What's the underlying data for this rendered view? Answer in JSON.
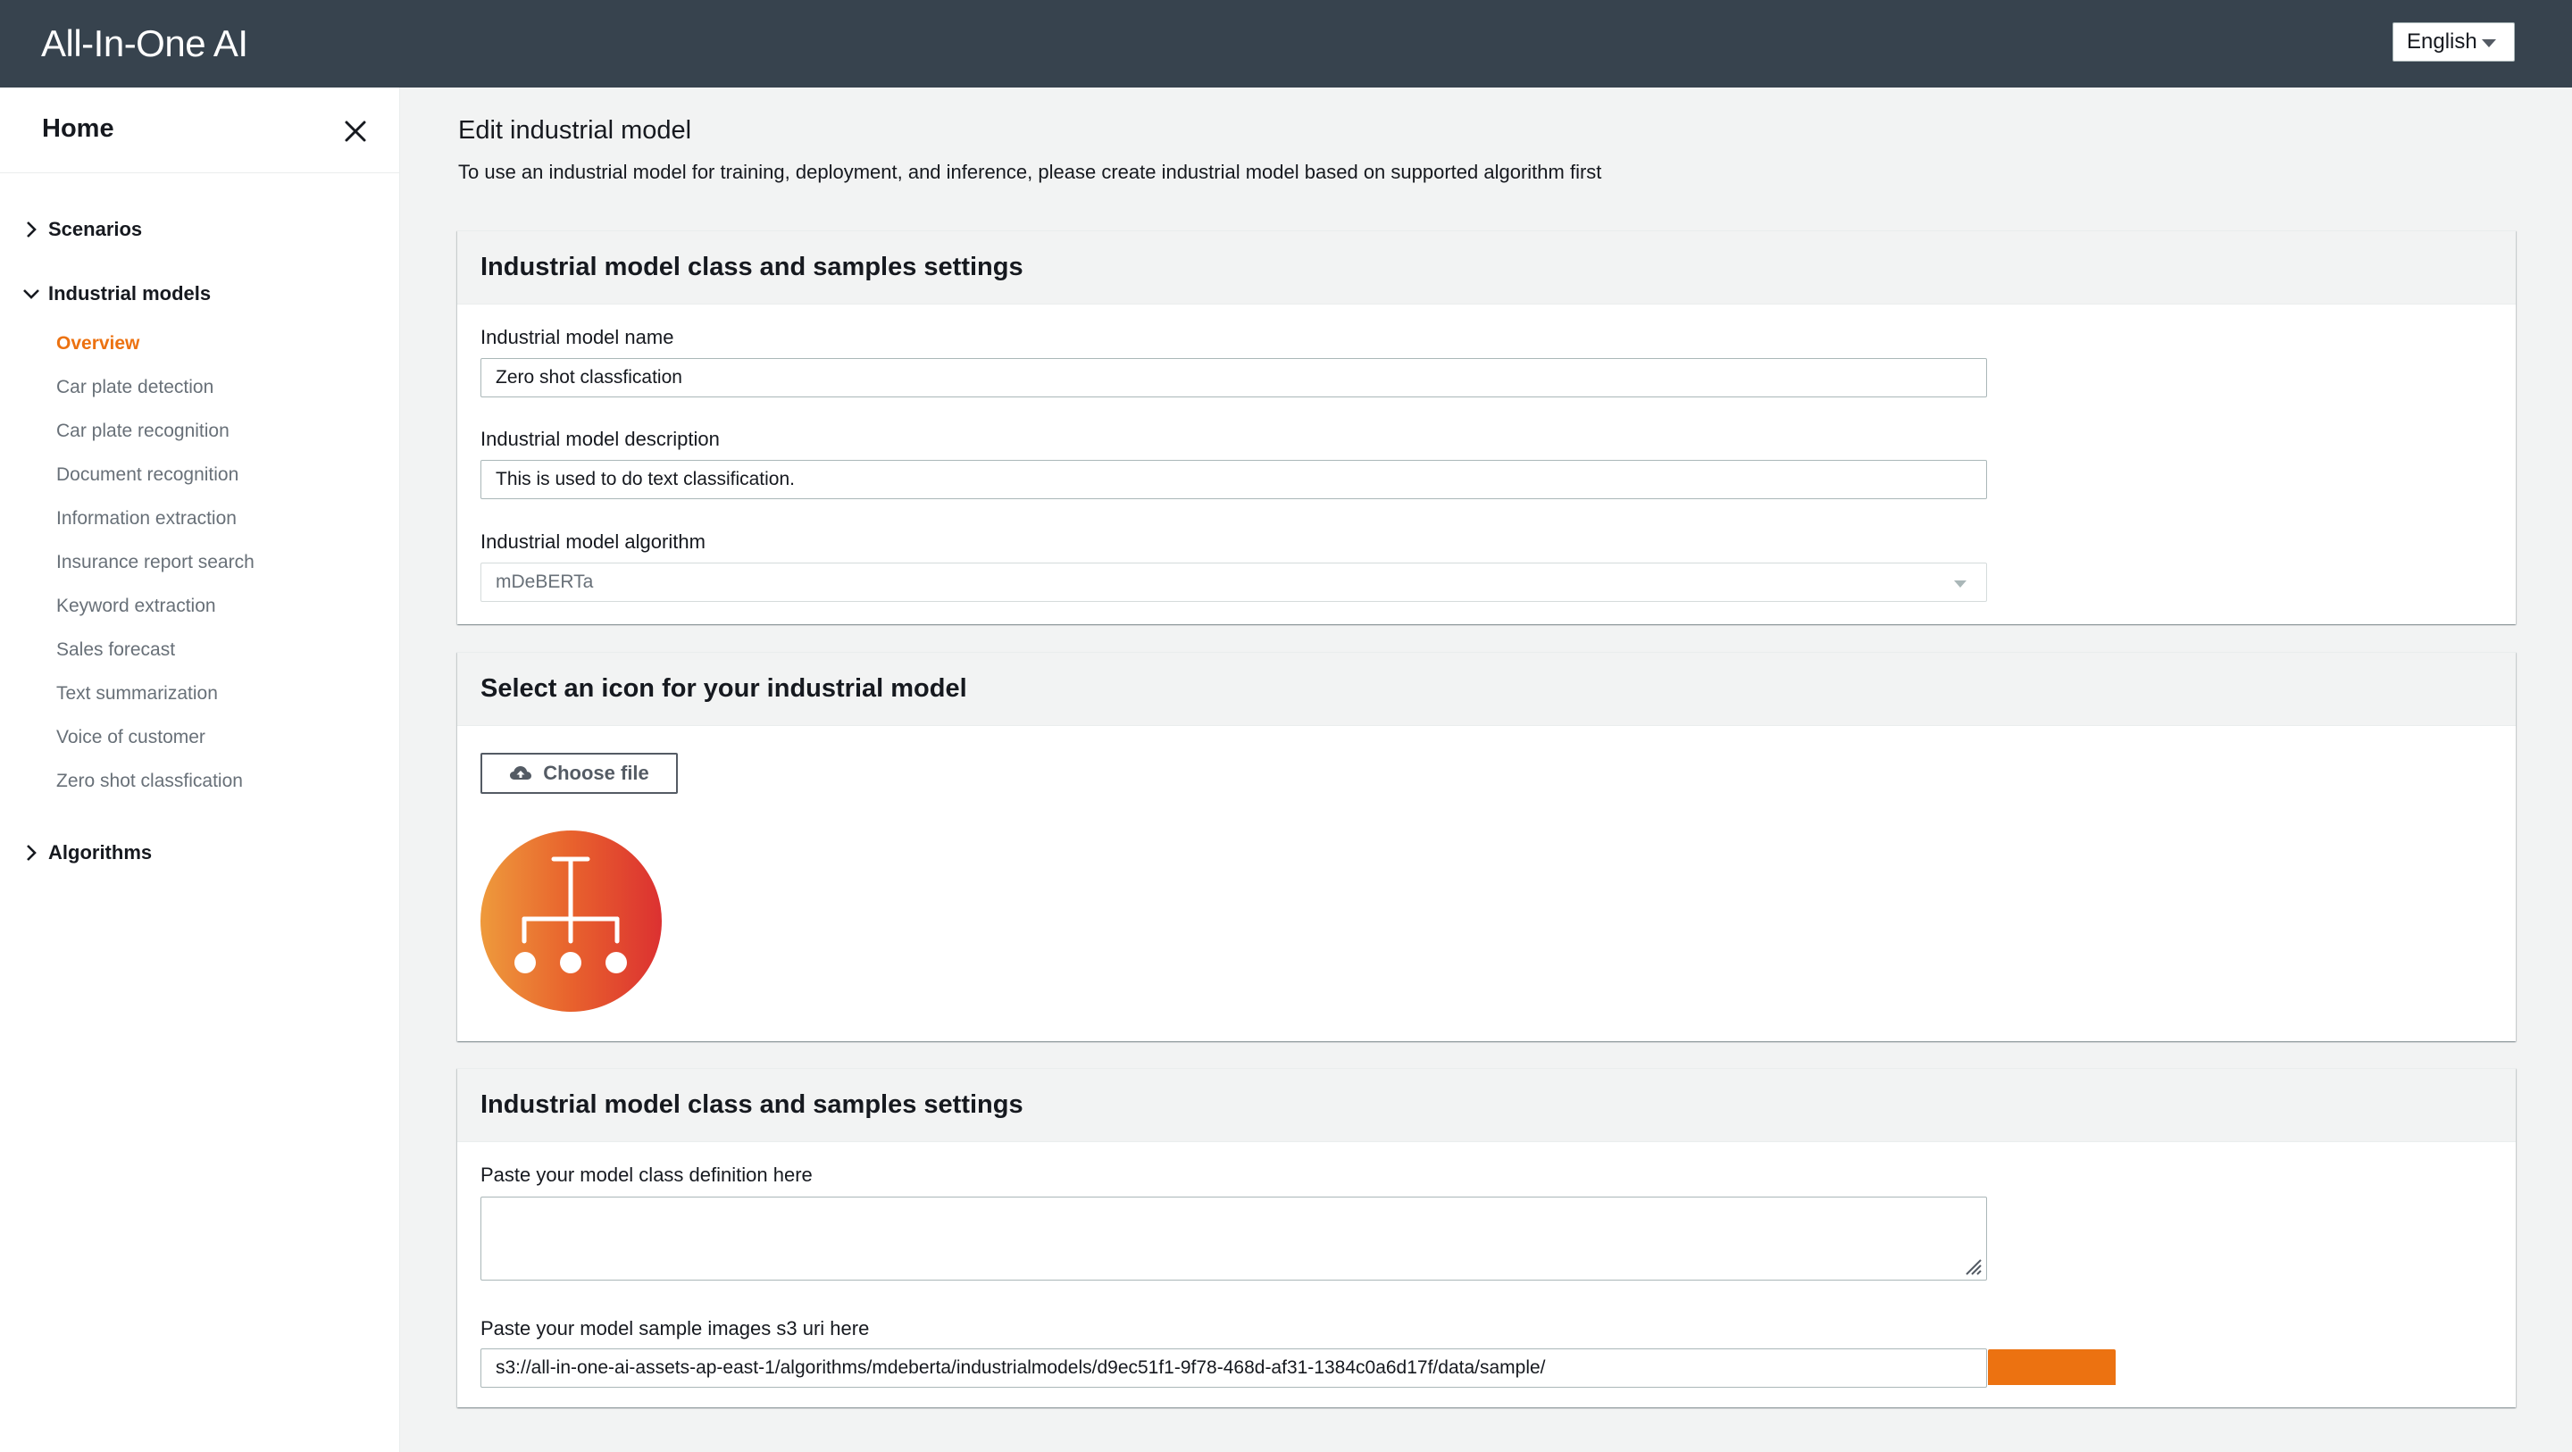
{
  "header": {
    "app_title": "All-In-One AI",
    "language": "English"
  },
  "sidebar": {
    "home": "Home",
    "sections": [
      {
        "label": "Scenarios",
        "expanded": false
      },
      {
        "label": "Industrial models",
        "expanded": true
      },
      {
        "label": "Algorithms",
        "expanded": false
      }
    ],
    "items": [
      {
        "label": "Overview",
        "active": true
      },
      {
        "label": "Car plate detection"
      },
      {
        "label": "Car plate recognition"
      },
      {
        "label": "Document recognition"
      },
      {
        "label": "Information extraction"
      },
      {
        "label": "Insurance report search"
      },
      {
        "label": "Keyword extraction"
      },
      {
        "label": "Sales forecast"
      },
      {
        "label": "Text summarization"
      },
      {
        "label": "Voice of customer"
      },
      {
        "label": "Zero shot classfication"
      }
    ]
  },
  "main": {
    "title": "Edit industrial model",
    "description": "To use an industrial model for training, deployment, and inference, please create industrial model based on supported algorithm first",
    "panel1": {
      "title": "Industrial model class and samples settings",
      "name_label": "Industrial model name",
      "name_value": "Zero shot classfication",
      "desc_label": "Industrial model description",
      "desc_value": "This is used to do text classification.",
      "algo_label": "Industrial model algorithm",
      "algo_value": "mDeBERTa"
    },
    "panel2": {
      "title": "Select an icon for your industrial model",
      "choose_file": "Choose file",
      "icon": "hierarchy-tree-icon"
    },
    "panel3": {
      "title": "Industrial model class and samples settings",
      "class_label": "Paste your model class definition here",
      "class_value": "",
      "uri_label": "Paste your model sample images s3 uri here",
      "uri_value": "s3://all-in-one-ai-assets-ap-east-1/algorithms/mdeberta/industrialmodels/d9ec51f1-9f78-468d-af31-1384c0a6d17f/data/sample/"
    }
  },
  "colors": {
    "topbar": "#37434e",
    "accent": "#ec7211",
    "muted_text": "#687078"
  }
}
